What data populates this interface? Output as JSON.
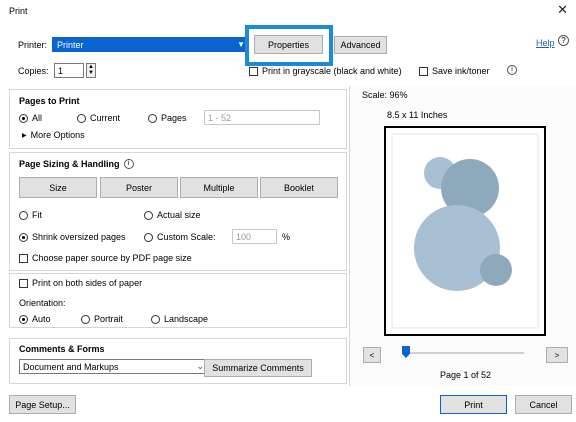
{
  "window": {
    "title": "Print",
    "close_glyph": "✕"
  },
  "printer": {
    "label": "Printer:",
    "value": "Printer",
    "properties_label": "Properties",
    "advanced_label": "Advanced",
    "help_label": "Help"
  },
  "copies": {
    "label": "Copies:",
    "value": "1"
  },
  "options": {
    "grayscale_label": "Print in grayscale (black and white)",
    "save_ink_label": "Save ink/toner"
  },
  "pages_to_print": {
    "title": "Pages to Print",
    "all_label": "All",
    "current_label": "Current",
    "pages_label": "Pages",
    "pages_placeholder": "1 - 52",
    "more_options_label": "More Options",
    "selected": "all"
  },
  "page_sizing": {
    "title": "Page Sizing & Handling",
    "buttons": [
      "Size",
      "Poster",
      "Multiple",
      "Booklet"
    ],
    "fit_label": "Fit",
    "actual_size_label": "Actual size",
    "shrink_label": "Shrink oversized pages",
    "custom_scale_label": "Custom Scale:",
    "custom_scale_value": "100",
    "percent": "%",
    "paper_source_label": "Choose paper source by PDF page size",
    "selected": "shrink"
  },
  "duplex": {
    "both_sides_label": "Print on both sides of paper",
    "orientation_label": "Orientation:",
    "auto_label": "Auto",
    "portrait_label": "Portrait",
    "landscape_label": "Landscape",
    "selected": "auto"
  },
  "comments": {
    "title": "Comments & Forms",
    "value": "Document and Markups",
    "summarize_label": "Summarize Comments"
  },
  "preview": {
    "scale_text": "Scale: 96%",
    "paper_size": "8.5 x 11 Inches",
    "page_text": "Page 1 of 52",
    "prev": "<",
    "next": ">"
  },
  "footer": {
    "page_setup_label": "Page Setup...",
    "print_label": "Print",
    "cancel_label": "Cancel"
  },
  "colors": {
    "accent": "#0a64d0",
    "highlight": "#1e8ad6",
    "circle_light": "#a9bfd3",
    "circle_dark": "#8fa9bc"
  }
}
